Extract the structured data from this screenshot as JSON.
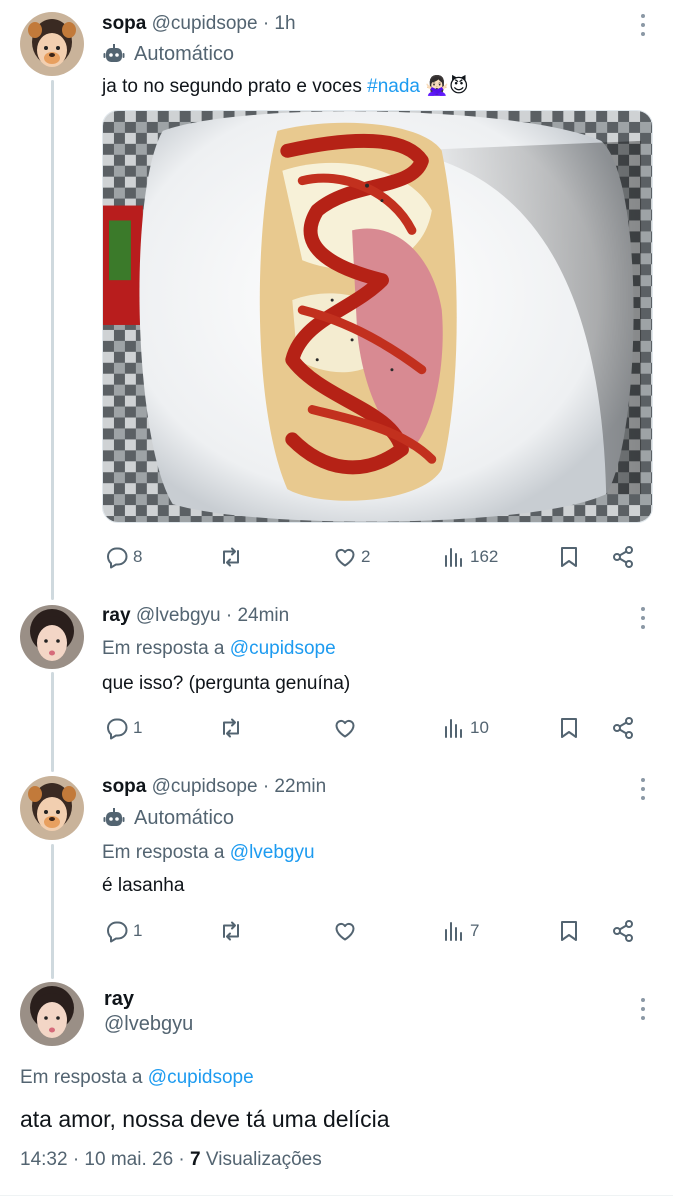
{
  "tweet1": {
    "name": "sopa",
    "handle": "@cupidsope · 1h",
    "automated": "Automático",
    "text_before": "ja to no segundo prato e voces ",
    "hashtag": "#nada",
    "emoji": "🙅🏻‍♀️😈",
    "image_alt": "prato de lasanha com ketchup",
    "stats": {
      "replies": "8",
      "retweets": "",
      "likes": "2",
      "views": "162"
    }
  },
  "tweet2": {
    "name": "ray",
    "handle": "@lvebgyu · 24min",
    "reply_prefix": "Em resposta a ",
    "reply_to": "@cupidsope",
    "text": "que isso? (pergunta genuína)",
    "stats": {
      "replies": "1",
      "retweets": "",
      "likes": "",
      "views": "10"
    }
  },
  "tweet3": {
    "name": "sopa",
    "handle": "@cupidsope · 22min",
    "automated": "Automático",
    "reply_prefix": "Em resposta a ",
    "reply_to": "@lvebgyu",
    "text": "é lasanha",
    "stats": {
      "replies": "1",
      "retweets": "",
      "likes": "",
      "views": "7"
    }
  },
  "main_tweet": {
    "name": "ray",
    "handle": "@lvebgyu",
    "reply_prefix": "Em resposta a ",
    "reply_to": "@cupidsope",
    "text": "ata amor, nossa deve tá uma delícia",
    "time": "14:32 · 10 mai. 26 · ",
    "views_count": "7",
    "views_label": " Visualizações"
  },
  "colors": {
    "accent": "#1d9bf0",
    "muted": "#536471",
    "thread_line": "#cfd9de"
  }
}
